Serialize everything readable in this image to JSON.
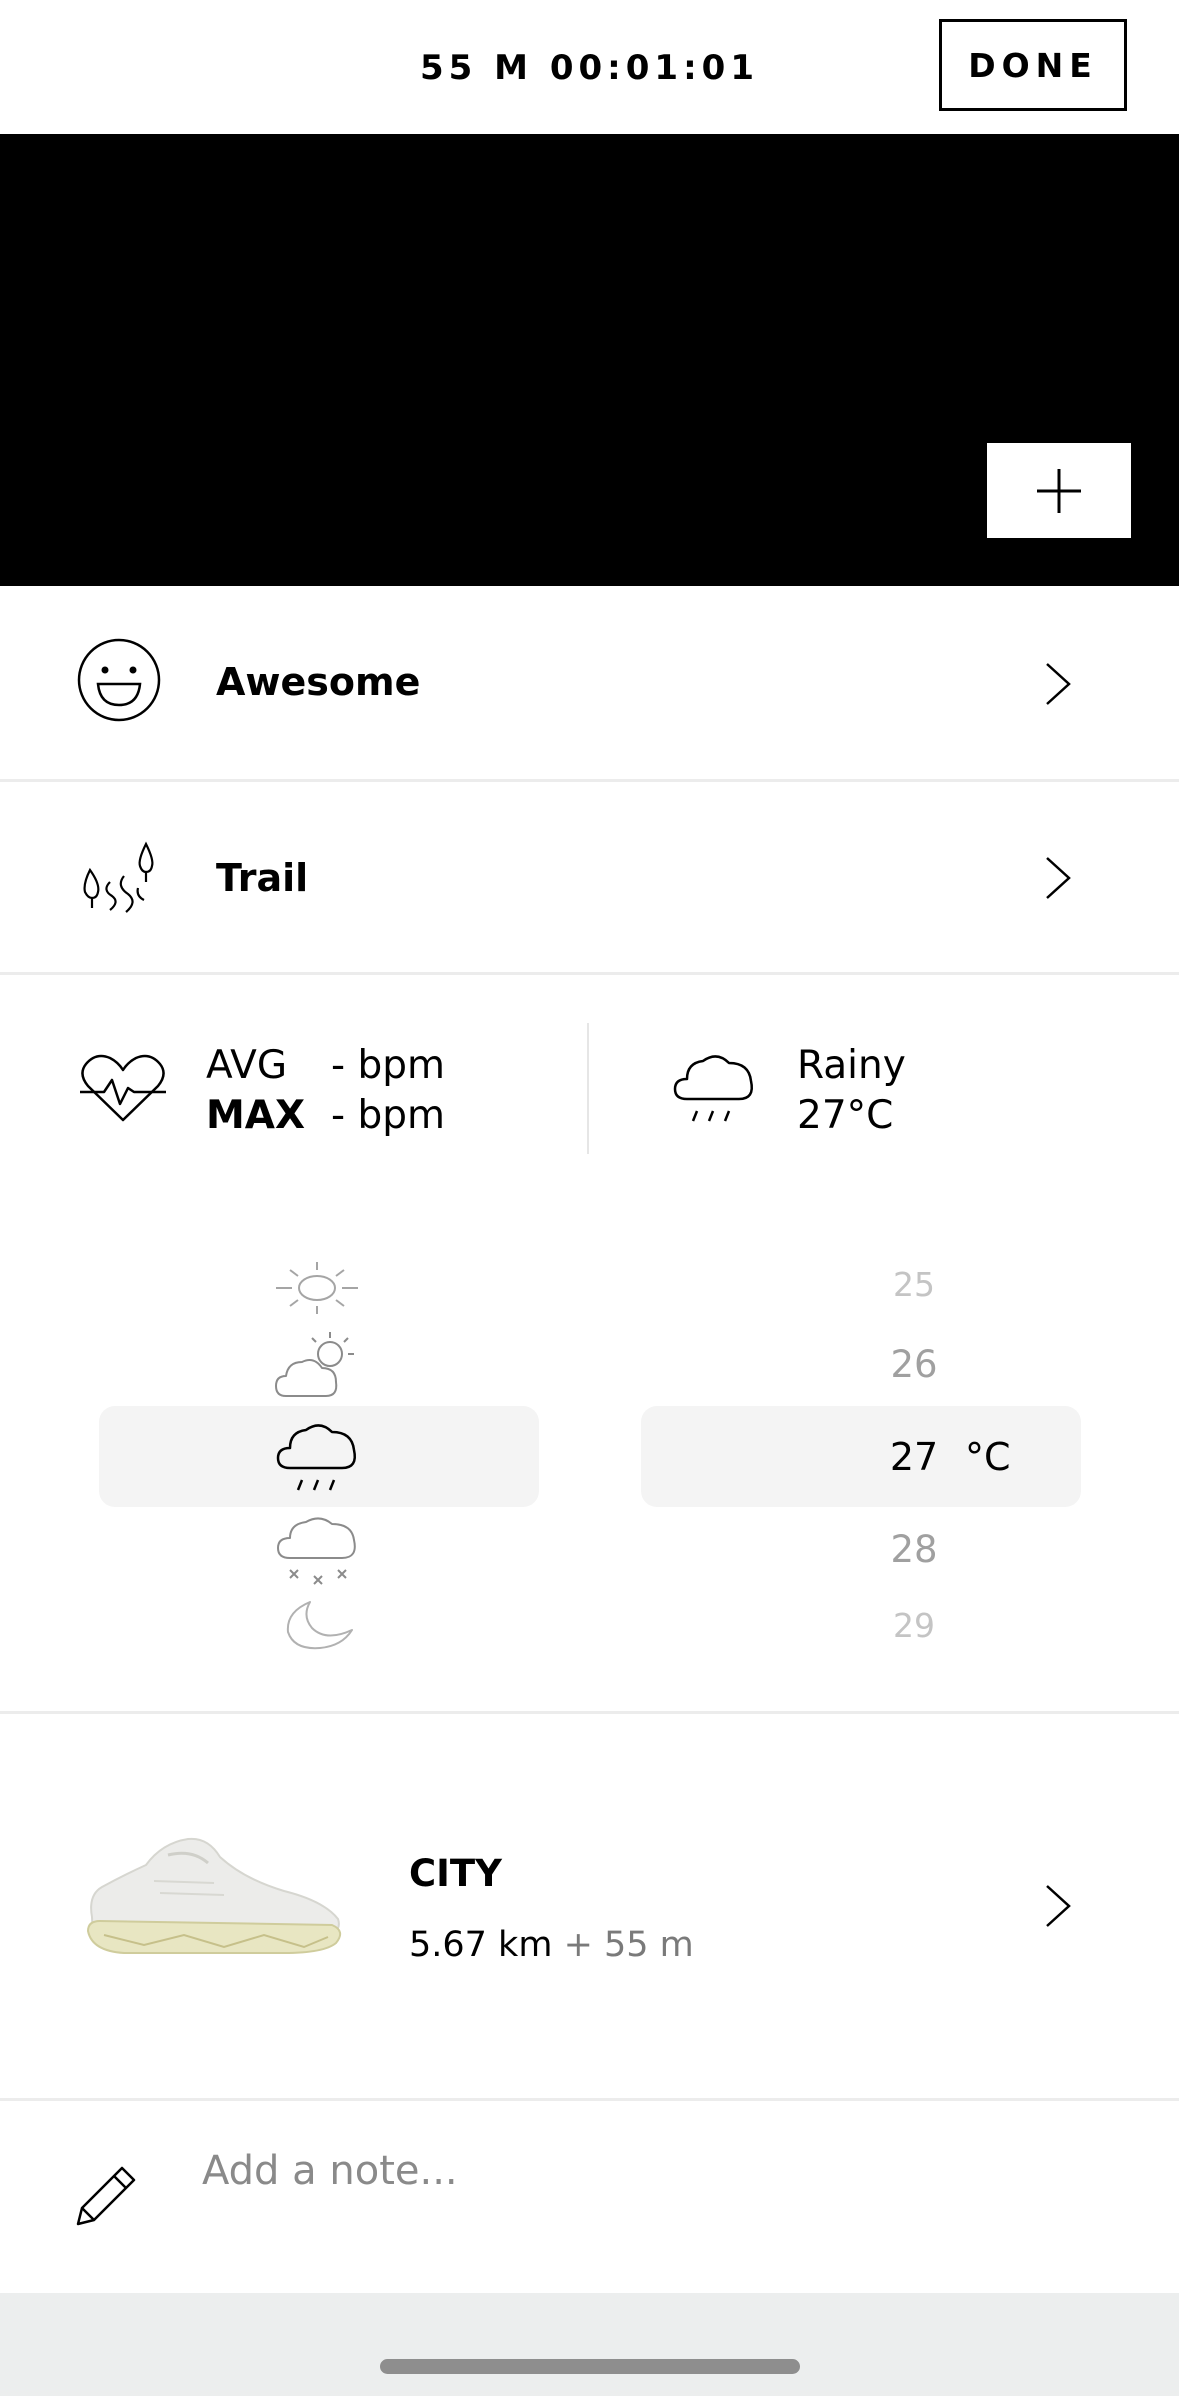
{
  "header": {
    "timer": "55 M 00:01:01",
    "done_label": "DONE"
  },
  "hero": {
    "add_icon": "plus-icon"
  },
  "mood": {
    "label": "Awesome",
    "icon": "smiley-icon"
  },
  "surface": {
    "label": "Trail",
    "icon": "trail-icon"
  },
  "heart_rate": {
    "avg_label": "AVG",
    "avg_value": "- bpm",
    "max_label": "MAX",
    "max_value": "- bpm"
  },
  "weather": {
    "condition": "Rainy",
    "temperature": "27°C",
    "picker_icons": [
      "sun-icon",
      "partly-cloudy-icon",
      "rain-cloud-icon",
      "snow-cloud-icon",
      "moon-icon"
    ],
    "selected_icon": "rain-cloud-icon",
    "temp_options": [
      "25",
      "26",
      "27",
      "28",
      "29"
    ],
    "selected_temp": "27",
    "unit": "°C"
  },
  "shoe": {
    "name": "CITY",
    "distance": "5.67 km",
    "extra": "+ 55 m"
  },
  "note": {
    "placeholder": "Add a note..."
  }
}
